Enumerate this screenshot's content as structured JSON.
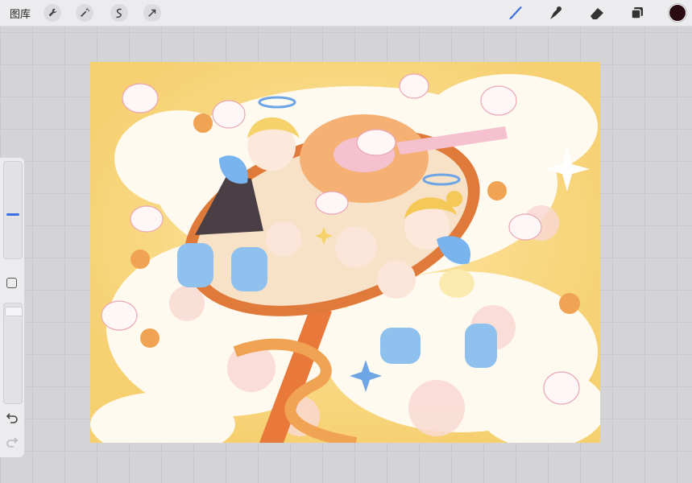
{
  "topbar": {
    "gallery_label": "图库",
    "tools_left": [
      "wrench-icon",
      "magic-wand-icon",
      "selection-icon",
      "transform-arrow-icon"
    ],
    "tools_right": [
      "brush-icon",
      "smudge-icon",
      "eraser-icon",
      "layers-icon"
    ],
    "current_color": "#2a0b12",
    "active_tool_color": "#3b6fe0"
  },
  "sidebar": {
    "controls": [
      "brush-size-slider",
      "modify-button",
      "opacity-slider",
      "undo-button",
      "redo-button"
    ]
  },
  "canvas": {
    "palette": {
      "background": "#f6cf6e",
      "cloud": "#fffaf0",
      "orange": "#f0a353",
      "spoon_pink": "#f5c1cf",
      "boots_blue": "#8ec1ee"
    }
  }
}
